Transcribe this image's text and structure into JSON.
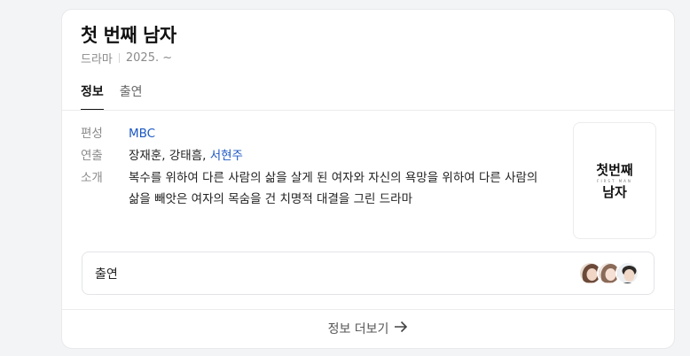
{
  "header": {
    "title": "첫 번째 남자",
    "genre": "드라마",
    "year": "2025. ~"
  },
  "tabs": [
    {
      "label": "정보",
      "active": true
    },
    {
      "label": "출연",
      "active": false
    }
  ],
  "info": {
    "network_label": "편성",
    "network_value": "MBC",
    "director_label": "연출",
    "directors": [
      "장재훈",
      "강태흠",
      "서현주"
    ],
    "summary_label": "소개",
    "summary": "복수를 위하여 다른 사람의 삶을 살게 된 여자와 자신의 욕망을 위하여 다른 사람의 삶을 빼앗은 여자의 목숨을 건 치명적 대결을 그린 드라마"
  },
  "poster": {
    "line1": "첫번째",
    "small_text": "FIRST MAN",
    "line2": "남자"
  },
  "cast": {
    "label": "출연",
    "avatars": [
      "avatar-1",
      "avatar-2",
      "avatar-3"
    ]
  },
  "more": {
    "label": "정보 더보기"
  },
  "colors": {
    "link": "#1c58c4",
    "muted": "#8a8a8a",
    "text": "#222222"
  }
}
